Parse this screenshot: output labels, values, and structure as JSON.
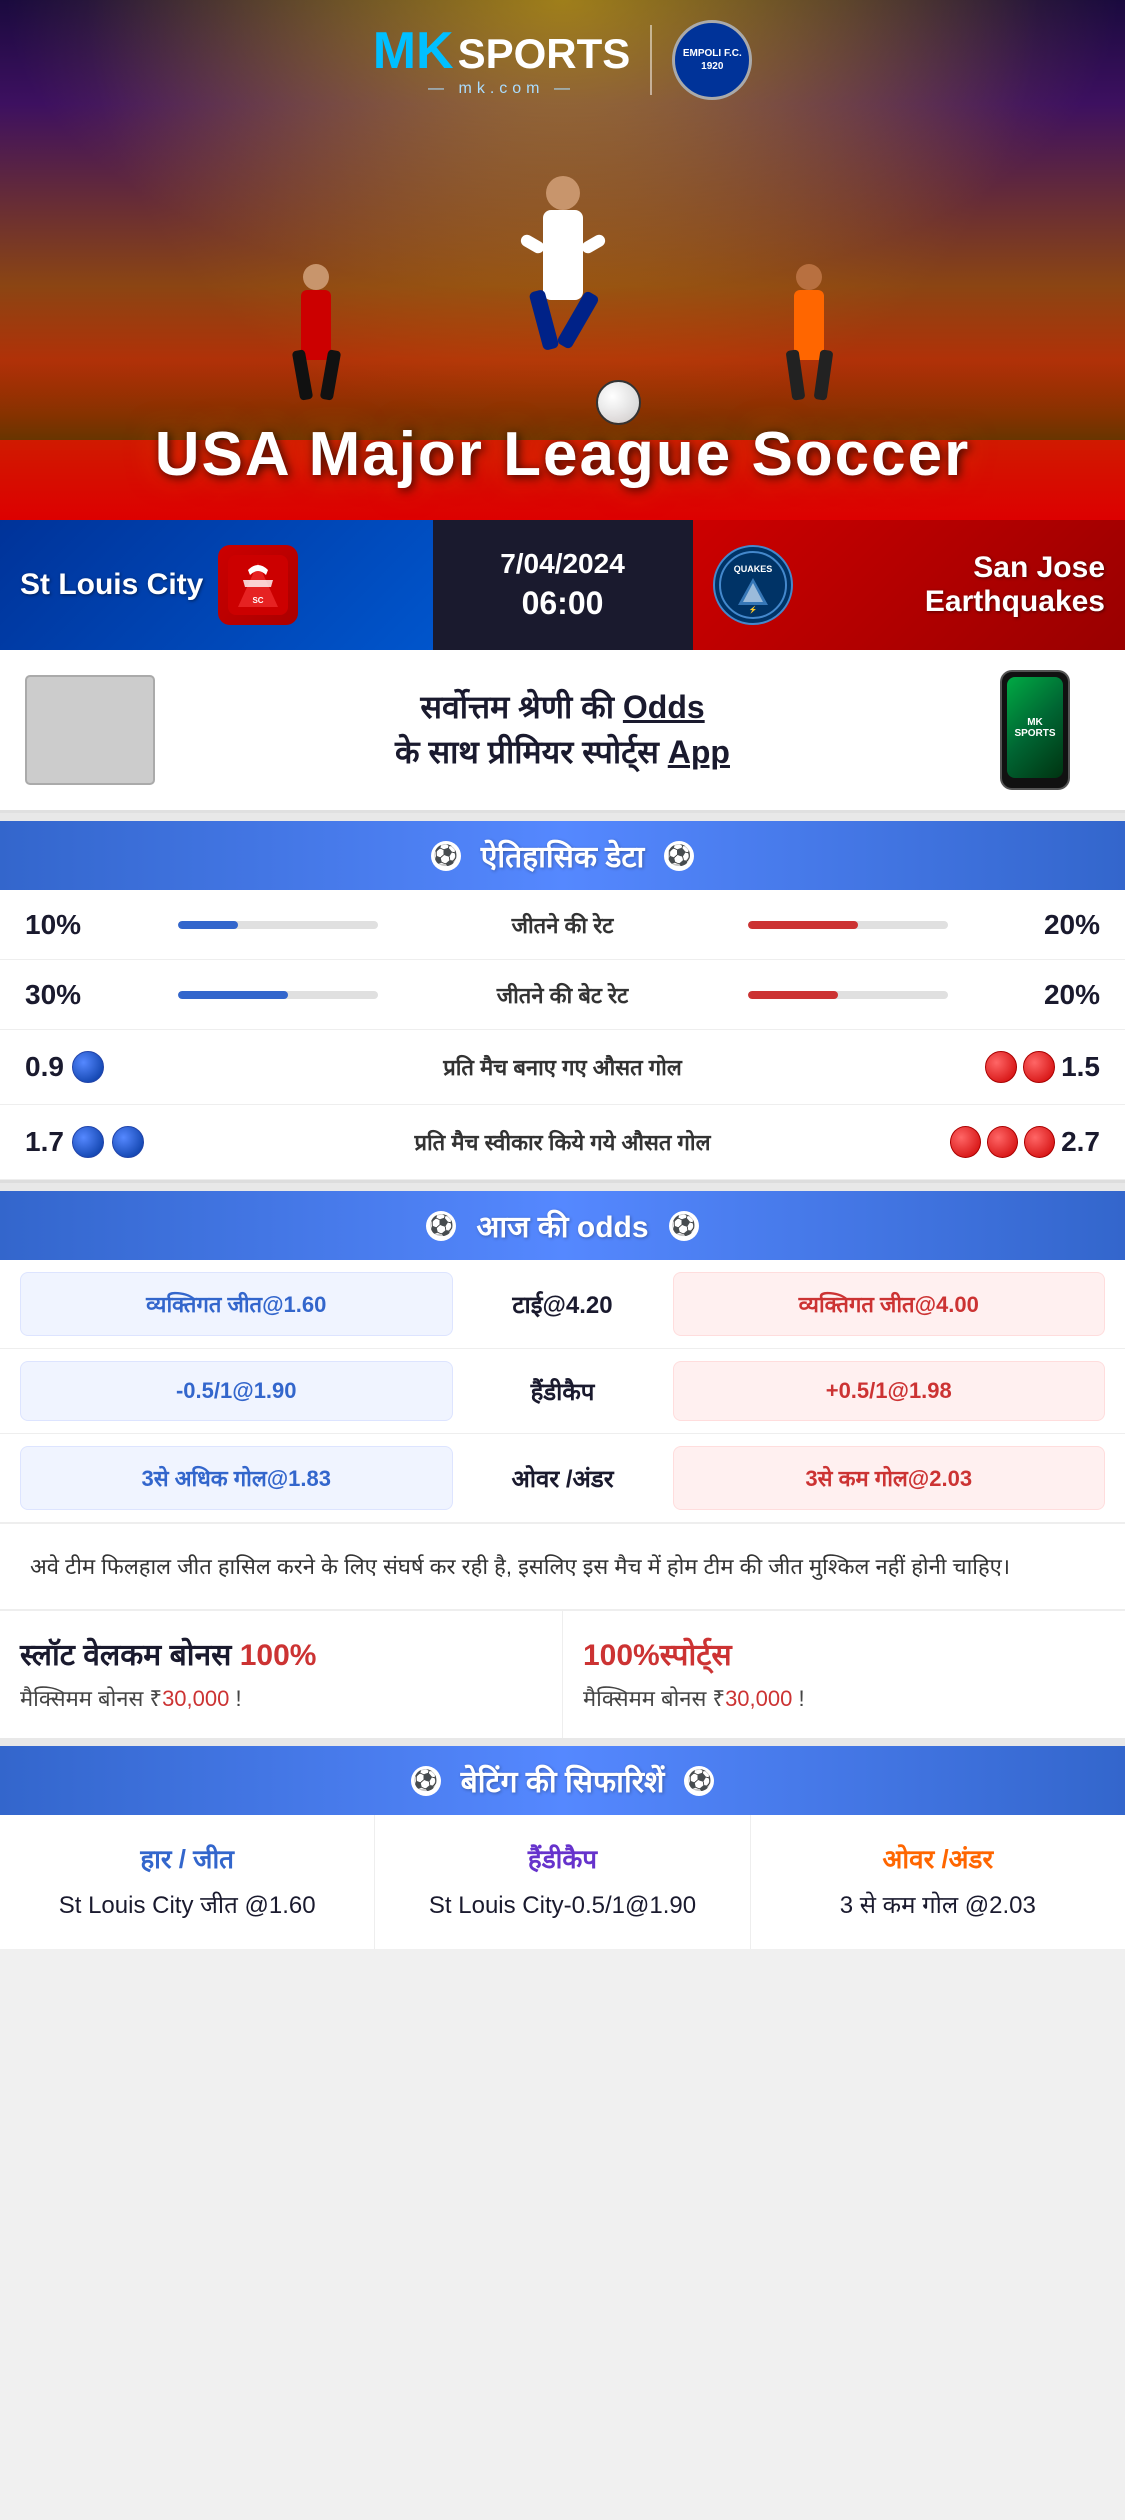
{
  "brand": {
    "mk_prefix": "MK",
    "sports_label": "SPORTS",
    "com_label": "— mk.com —",
    "empoli_label": "EMPOLI F.C.\n1920"
  },
  "hero": {
    "title": "USA Major League Soccer"
  },
  "match": {
    "team_left": "St Louis City",
    "team_right": "San Jose Earthquakes",
    "date": "7/04/2024",
    "time": "06:00",
    "quakes_label": "QUAKES"
  },
  "promo": {
    "text": "सर्वोत्तम श्रेणी की Odds के साथ प्रीमियर स्पोर्ट्स App",
    "odds_word": "Odds"
  },
  "historical": {
    "section_title": "ऐतिहासिक डेटा",
    "rows": [
      {
        "label": "जीतने की रेट",
        "left_val": "10%",
        "right_val": "20%",
        "left_pct": 30,
        "right_pct": 55
      },
      {
        "label": "जीतने की बेट रेट",
        "left_val": "30%",
        "right_val": "20%",
        "left_pct": 55,
        "right_pct": 45
      }
    ],
    "goals_rows": [
      {
        "label": "प्रति मैच बनाए गए औसत गोल",
        "left_val": "0.9",
        "right_val": "1.5",
        "left_balls": 1,
        "right_balls": 2
      },
      {
        "label": "प्रति मैच स्वीकार किये गये औसत गोल",
        "left_val": "1.7",
        "right_val": "2.7",
        "left_balls": 2,
        "right_balls": 3
      }
    ]
  },
  "odds": {
    "section_title": "आज की odds",
    "rows": [
      {
        "left_label": "व्यक्तिगत जीत@1.60",
        "center_label": "टाई@4.20",
        "right_label": "व्यक्तिगत जीत@4.00",
        "left_color": "blue",
        "right_color": "red"
      },
      {
        "left_label": "-0.5/1@1.90",
        "center_label": "हैंडीकैप",
        "right_label": "+0.5/1@1.98",
        "left_color": "blue",
        "right_color": "red"
      },
      {
        "left_label": "3से अधिक गोल@1.83",
        "center_label": "ओवर /अंडर",
        "right_label": "3से कम गोल@2.03",
        "left_color": "blue",
        "right_color": "red"
      }
    ]
  },
  "analysis": {
    "text": "अवे टीम फिलहाल जीत हासिल करने के लिए संघर्ष कर रही है, इसलिए इस मैच में होम टीम की जीत मुश्किल नहीं होनी चाहिए।"
  },
  "bonus": {
    "left": {
      "title_prefix": "स्लॉट वेलकम बोनस ",
      "title_pct": "100%",
      "subtitle_prefix": "मैक्सिमम बोनस ₹",
      "subtitle_amount": "30,000",
      "subtitle_suffix": " !"
    },
    "right": {
      "title": "100%स्पोर्ट्स",
      "subtitle_prefix": "मैक्सिमम बोनस  ₹",
      "subtitle_amount": "30,000",
      "subtitle_suffix": " !"
    }
  },
  "recommendations": {
    "section_title": "बेटिंग की सिफारिशें",
    "cols": [
      {
        "type": "हार / जीत",
        "type_color": "blue",
        "pick": "St Louis City जीत @1.60"
      },
      {
        "type": "हैंडीकैप",
        "type_color": "purple",
        "pick": "St Louis City-0.5/1@1.90"
      },
      {
        "type": "ओवर /अंडर",
        "type_color": "orange",
        "pick": "3 से कम गोल @2.03"
      }
    ]
  }
}
